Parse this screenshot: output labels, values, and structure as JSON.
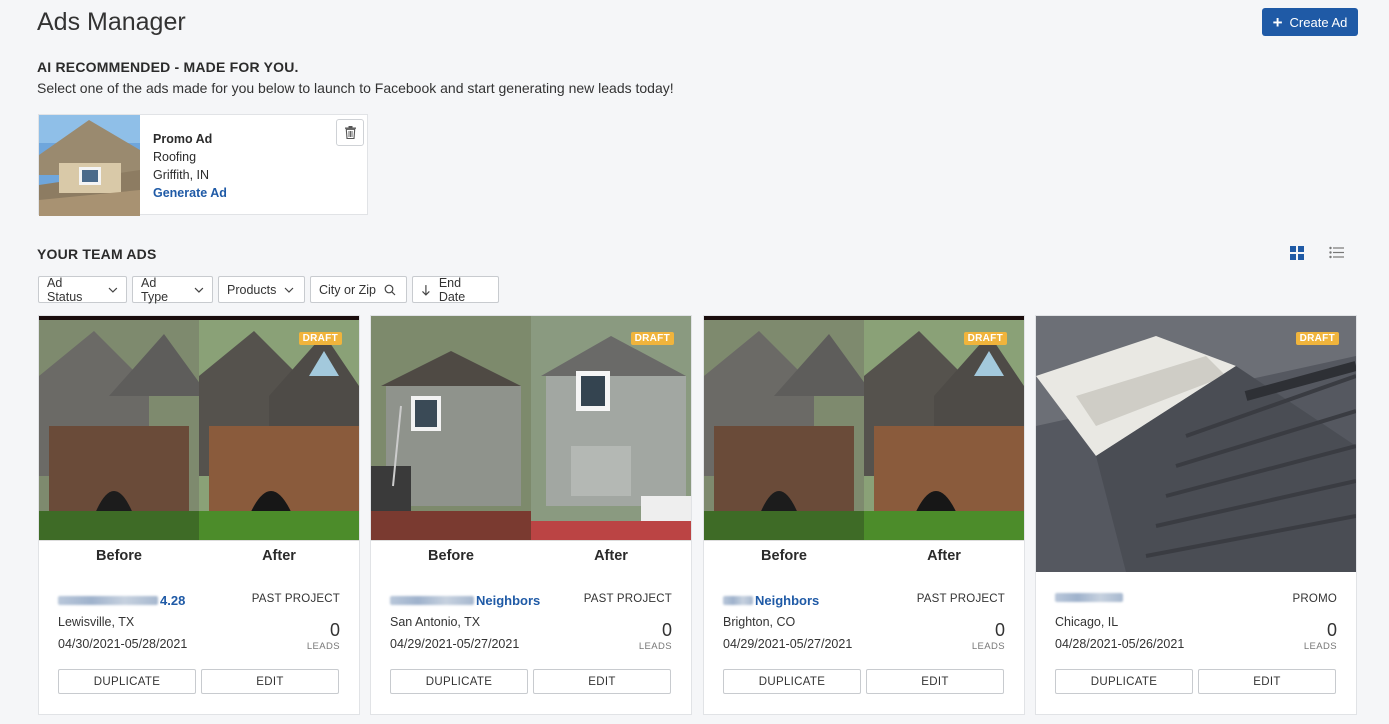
{
  "header": {
    "title": "Ads Manager",
    "create_label": "Create Ad"
  },
  "recommended": {
    "title": "AI RECOMMENDED - MADE FOR YOU.",
    "subtitle": "Select one of the ads made for you below to launch to Facebook and start generating new leads today!",
    "card": {
      "title": "Promo Ad",
      "category": "Roofing",
      "location": "Griffith, IN",
      "action": "Generate Ad"
    }
  },
  "team": {
    "title": "YOUR TEAM ADS",
    "filters": {
      "status": "Ad Status",
      "type": "Ad Type",
      "products": "Products",
      "city": "City or Zip",
      "end_date": "End Date"
    }
  },
  "ads": [
    {
      "badge": "DRAFT",
      "before": "Before",
      "after": "After",
      "name": "4.28",
      "type": "PAST PROJECT",
      "city": "Lewisville, TX",
      "dates": "04/30/2021-05/28/2021",
      "leads": "0",
      "leads_label": "LEADS",
      "dup": "DUPLICATE",
      "edit": "EDIT"
    },
    {
      "badge": "DRAFT",
      "before": "Before",
      "after": "After",
      "name": "Neighbors",
      "type": "PAST PROJECT",
      "city": "San Antonio, TX",
      "dates": "04/29/2021-05/27/2021",
      "leads": "0",
      "leads_label": "LEADS",
      "dup": "DUPLICATE",
      "edit": "EDIT"
    },
    {
      "badge": "DRAFT",
      "before": "Before",
      "after": "After",
      "name": "Neighbors",
      "type": "PAST PROJECT",
      "city": "Brighton, CO",
      "dates": "04/29/2021-05/27/2021",
      "leads": "0",
      "leads_label": "LEADS",
      "dup": "DUPLICATE",
      "edit": "EDIT"
    },
    {
      "badge": "DRAFT",
      "name": "",
      "type": "PROMO",
      "city": "Chicago, IL",
      "dates": "04/28/2021-05/26/2021",
      "leads": "0",
      "leads_label": "LEADS",
      "dup": "DUPLICATE",
      "edit": "EDIT"
    }
  ],
  "icons": {
    "create": "plus-icon",
    "trash": "trash-icon",
    "grid_view": "grid-view-icon",
    "list_view": "list-view-icon",
    "chevron": "chevron-down-icon",
    "search": "search-icon",
    "sort": "arrow-down-icon"
  },
  "colors": {
    "primary": "#1f5aa6",
    "draft_badge": "#f0b43c",
    "background": "#f5f6f8"
  }
}
